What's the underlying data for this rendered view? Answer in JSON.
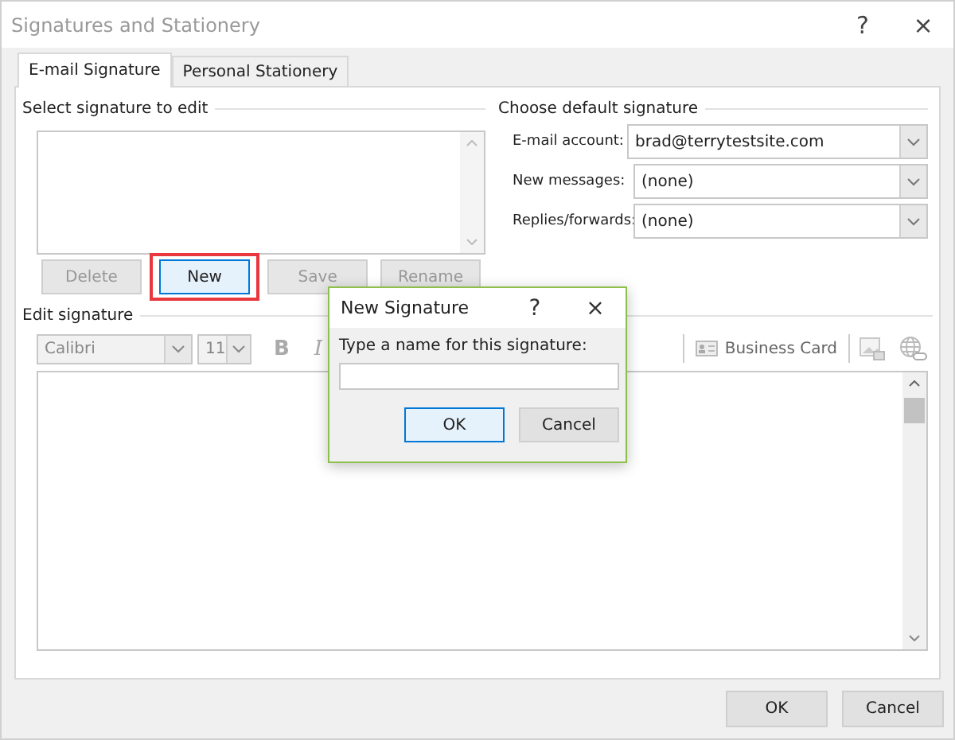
{
  "window": {
    "title": "Signatures and Stationery",
    "help": "?",
    "close": "×"
  },
  "tabs": [
    {
      "label": "E-mail Signature",
      "selected": true
    },
    {
      "label": "Personal Stationery",
      "selected": false
    }
  ],
  "select_section": {
    "label": "Select signature to edit",
    "buttons": [
      {
        "label": "Delete",
        "disabled": true,
        "highlighted": false
      },
      {
        "label": "New",
        "disabled": false,
        "highlighted": true
      },
      {
        "label": "Save",
        "disabled": true,
        "highlighted": false
      },
      {
        "label": "Rename",
        "disabled": true,
        "highlighted": false
      }
    ]
  },
  "default_section": {
    "label": "Choose default signature",
    "fields": [
      {
        "label": "E-mail account:",
        "value": "brad@terrytestsite.com"
      },
      {
        "label": "New messages:",
        "value": "(none)"
      },
      {
        "label": "Replies/forwards:",
        "value": "(none)"
      }
    ]
  },
  "edit_section": {
    "label": "Edit signature",
    "font": "Calibri",
    "size": "11",
    "bold": "B",
    "italic": "I",
    "business_card": "Business Card"
  },
  "buttons": [
    "OK",
    "Cancel"
  ],
  "dialog": {
    "title": "New Signature",
    "help": "?",
    "close": "×",
    "prompt": "Type a name for this signature:",
    "buttons": [
      "OK",
      "Cancel"
    ]
  }
}
